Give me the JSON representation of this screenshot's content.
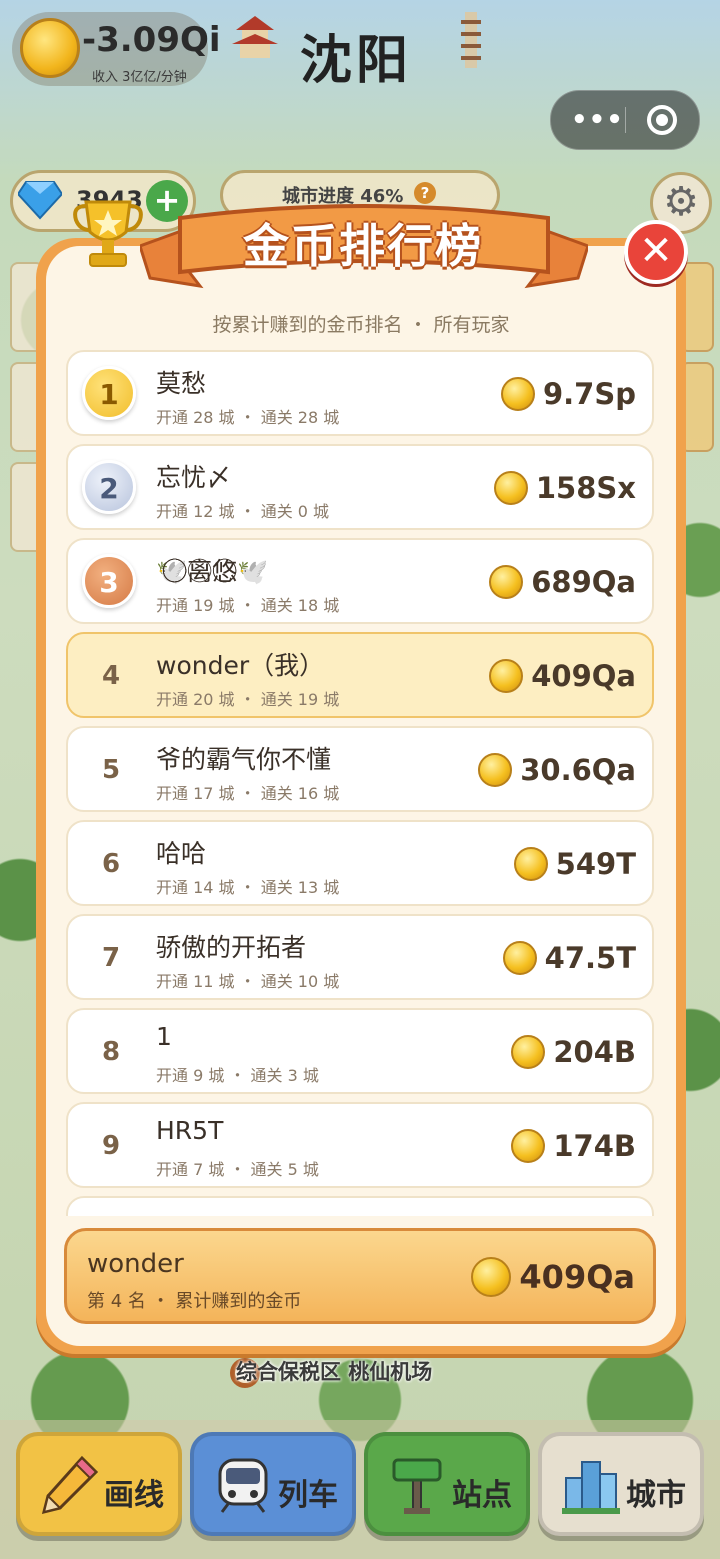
{
  "header": {
    "coins": "-3.09Qi",
    "income": "收入 3亿亿/分钟",
    "city": "沈阳",
    "gems": "3943",
    "gem_add": "+",
    "progress": "城市进度 46%",
    "help": "?"
  },
  "capsule": {
    "more": "•••"
  },
  "leaderboard": {
    "title": "金币排行榜",
    "close": "✕",
    "subtitle": "按累计赚到的金币排名 ・ 所有玩家",
    "rows": [
      {
        "rank": "1",
        "name": "莫愁",
        "stats": "开通 28 城 ・ 通关 28 城",
        "score": "9.7Sp"
      },
      {
        "rank": "2",
        "name": "忘忧〆",
        "stats": "开通 12 城 ・ 通关 0 城",
        "score": "158Sx"
      },
      {
        "rank": "3",
        "name": "🕊️⃝⃝⃝⃝⃝离⃝悠⃝⃝🕊️",
        "stats": "开通 19 城 ・ 通关 18 城",
        "score": "689Qa"
      },
      {
        "rank": "4",
        "name": "wonder（我）",
        "stats": "开通 20 城 ・ 通关 19 城",
        "score": "409Qa"
      },
      {
        "rank": "5",
        "name": "爷的霸气你不懂",
        "stats": "开通 17 城 ・ 通关 16 城",
        "score": "30.6Qa"
      },
      {
        "rank": "6",
        "name": "哈哈",
        "stats": "开通 14 城 ・ 通关 13 城",
        "score": "549T"
      },
      {
        "rank": "7",
        "name": "骄傲的开拓者",
        "stats": "开通 11 城 ・ 通关 10 城",
        "score": "47.5T"
      },
      {
        "rank": "8",
        "name": "1",
        "stats": "开通 9 城 ・ 通关 3 城",
        "score": "204B"
      },
      {
        "rank": "9",
        "name": "HR5T",
        "stats": "开通 7 城 ・ 通关 5 城",
        "score": "174B"
      }
    ],
    "me": {
      "name": "wonder",
      "sub": "第 4 名 ・ 累计赚到的金币",
      "score": "409Qa"
    }
  },
  "map": {
    "label": "综合保税区 桃仙机场"
  },
  "nav": [
    {
      "label": "画线",
      "icon": "pencil-icon",
      "color": "#f2c245"
    },
    {
      "label": "列车",
      "icon": "train-icon",
      "color": "#5b8fd6"
    },
    {
      "label": "站点",
      "icon": "signpost-icon",
      "color": "#5aa84a"
    },
    {
      "label": "城市",
      "icon": "buildings-icon",
      "color": "#e6dfcf"
    }
  ]
}
